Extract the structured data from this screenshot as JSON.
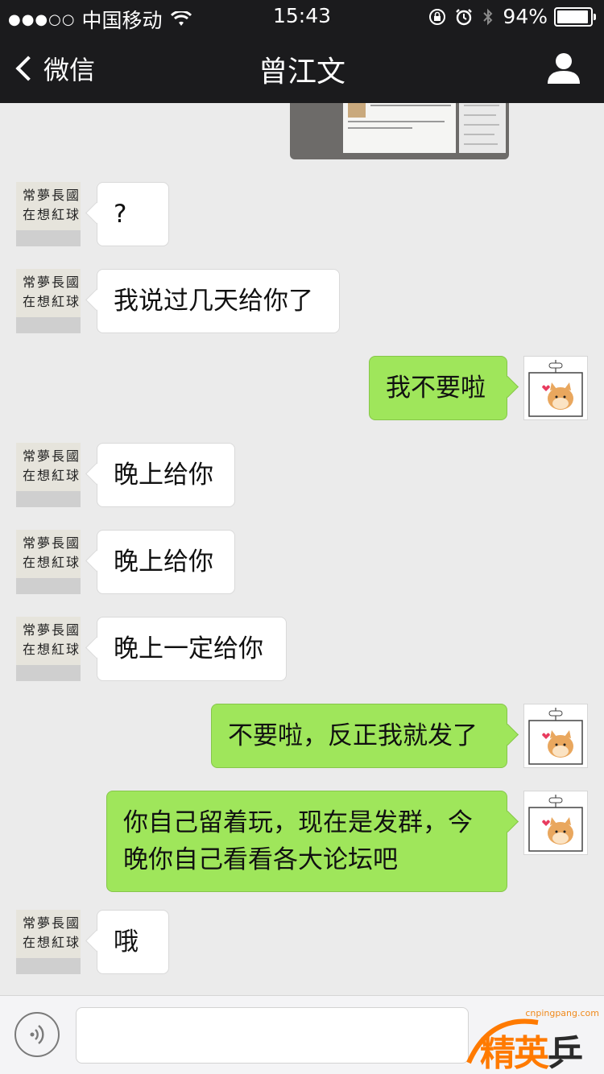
{
  "status_bar": {
    "signal": "●●●○○",
    "carrier": "中国移动",
    "time": "15:43",
    "battery": "94%",
    "battery_level": 0.94
  },
  "nav": {
    "back_label": "微信",
    "title": "曾江文"
  },
  "messages": [
    {
      "side": "peer",
      "text": "?"
    },
    {
      "side": "peer",
      "text": "我说过几天给你了"
    },
    {
      "side": "self",
      "text": "我不要啦"
    },
    {
      "side": "peer",
      "text": "晚上给你"
    },
    {
      "side": "peer",
      "text": "晚上给你"
    },
    {
      "side": "peer",
      "text": "晚上一定给你"
    },
    {
      "side": "self",
      "text": "不要啦，反正我就发了"
    },
    {
      "side": "self",
      "text": "你自己留着玩，现在是发群，今晚你自己看看各大论坛吧"
    },
    {
      "side": "peer",
      "text": "哦"
    }
  ],
  "avatar_peer": {
    "calligraphy": [
      "常",
      "夢",
      "長",
      "國",
      "在",
      "想",
      "紅",
      "球"
    ]
  },
  "watermark": {
    "url": "cnpingpang.com",
    "brand_a": "精英",
    "brand_b": "乒乓网"
  },
  "colors": {
    "bar_bg": "#1b1b1d",
    "chat_bg": "#ebebeb",
    "self_bubble": "#9fe65b",
    "peer_bubble": "#ffffff"
  }
}
